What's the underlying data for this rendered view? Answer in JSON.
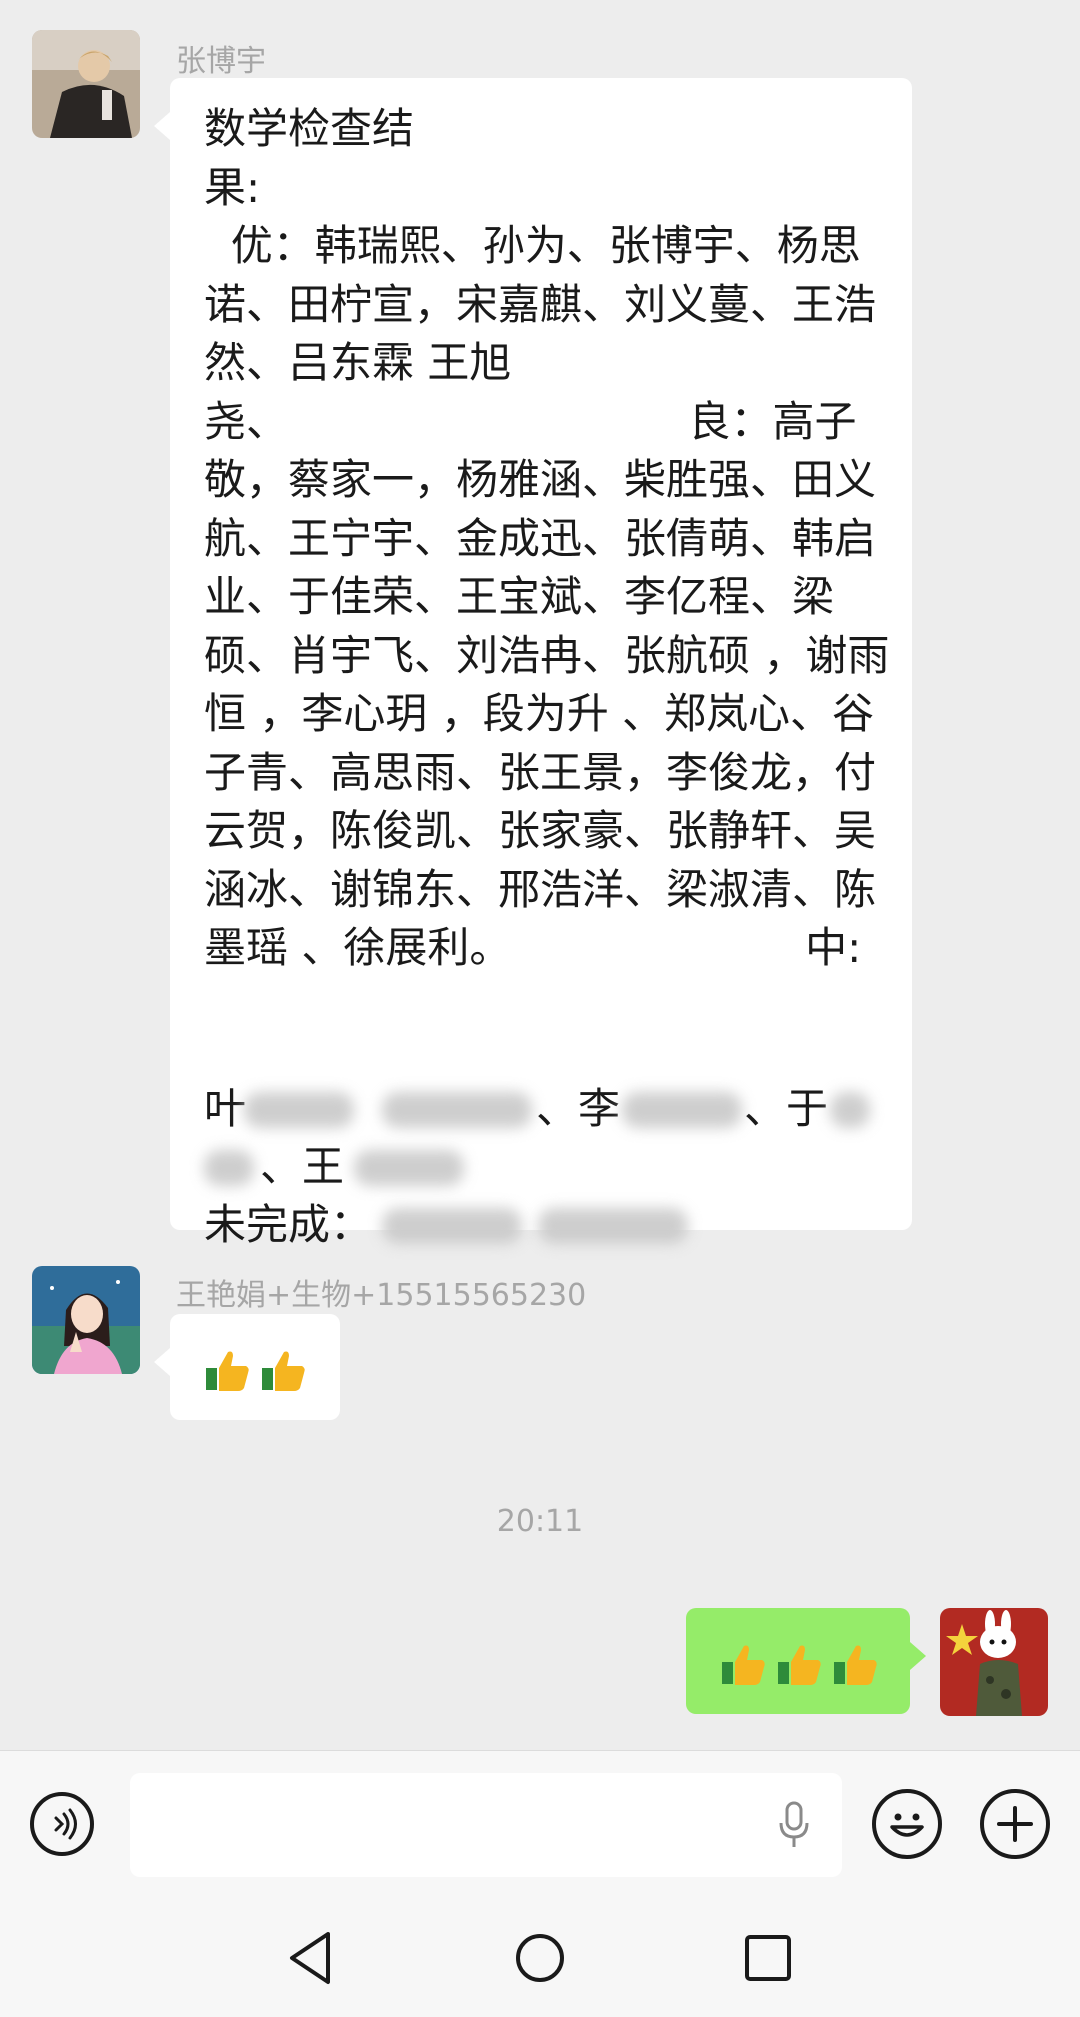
{
  "messages": [
    {
      "sender": "张博宇",
      "text": "数学检查结\n果:\n  优：韩瑞熙、孙为、张博宇、杨思诺、田柠宣，宋嘉麒、刘义蔓、王浩然、吕东霖 王旭\n尧、                              良：高子敬，蔡家一，杨雅涵、柴胜强、田义航、王宁宇、金成迅、张倩萌、韩启业、于佳荣、王宝斌、李亿程、梁硕、肖宇飞、刘浩冉、张航硕 ，谢雨恒 ，李心玥 ，段为升 、郑岚心、谷子青、高思雨、张王景，李俊龙，付云贺，陈俊凯、张家豪、张静轩、吴涵冰、谢锦东、邢浩洋、梁淑清、陈墨瑶 、徐展利。                      中:",
      "partial_line_1_prefix": "叶",
      "partial_line_1_mid": "、李",
      "partial_line_1_end": "、于",
      "partial_line_2_mid": "、王",
      "incomplete_label": "未完成："
    },
    {
      "sender": "王艳娟+生物+15515565230",
      "emoji": "👍👍"
    },
    {
      "emoji": "👍👍👍"
    }
  ],
  "timestamp": "20:11",
  "input": {
    "placeholder": ""
  },
  "icons": {
    "voice": "voice-icon",
    "mic": "microphone-icon",
    "emoji": "emoji-icon",
    "plus": "plus-icon",
    "back": "back-icon",
    "home": "home-icon",
    "recent": "recent-apps-icon"
  },
  "colors": {
    "background": "#ededed",
    "sent_bubble": "#95ec69",
    "received_bubble": "#ffffff",
    "meta_text": "#a6a6a6"
  }
}
